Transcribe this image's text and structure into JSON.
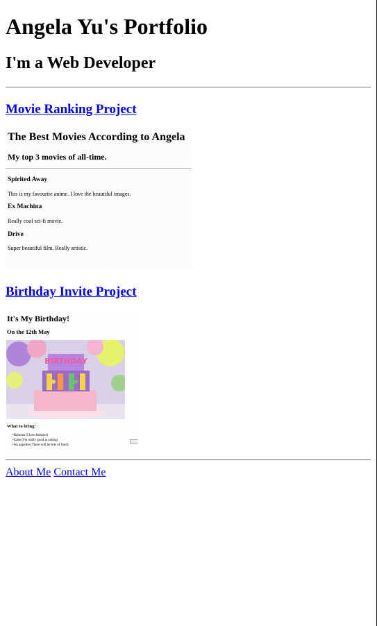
{
  "header": {
    "title": "Angela Yu's Portfolio",
    "subtitle": "I'm a Web Developer"
  },
  "projects": [
    {
      "link_text": "Movie Ranking Project",
      "preview": {
        "title": "The Best Movies According to Angela",
        "subtitle": "My top 3 movies of all-time.",
        "movies": [
          {
            "name": "Spirited Away",
            "desc": "This is my favourite anime. I love the beautiful images."
          },
          {
            "name": "Ex Machina",
            "desc": "Really cool sci-fi movie."
          },
          {
            "name": "Drive",
            "desc": "Super beautiful film. Really artistic."
          }
        ]
      }
    },
    {
      "link_text": "Birthday Invite Project",
      "preview": {
        "title": "It's My Birthday!",
        "date": "On the 12th May",
        "cake_text": "BIRTHDAY",
        "bring_heading": "What to bring:",
        "items": [
          "Baloons (I love baloons)",
          "Cake (I'm really good at eating)",
          "An appetite (There will be lots of food)"
        ]
      }
    }
  ],
  "footer": {
    "about": "About Me",
    "contact": "Contact Me"
  },
  "colors": {
    "link": "#0000EE",
    "rule": "#888888",
    "cake_purple": "#9b6bc6",
    "cake_pink": "#f4b6c8"
  }
}
